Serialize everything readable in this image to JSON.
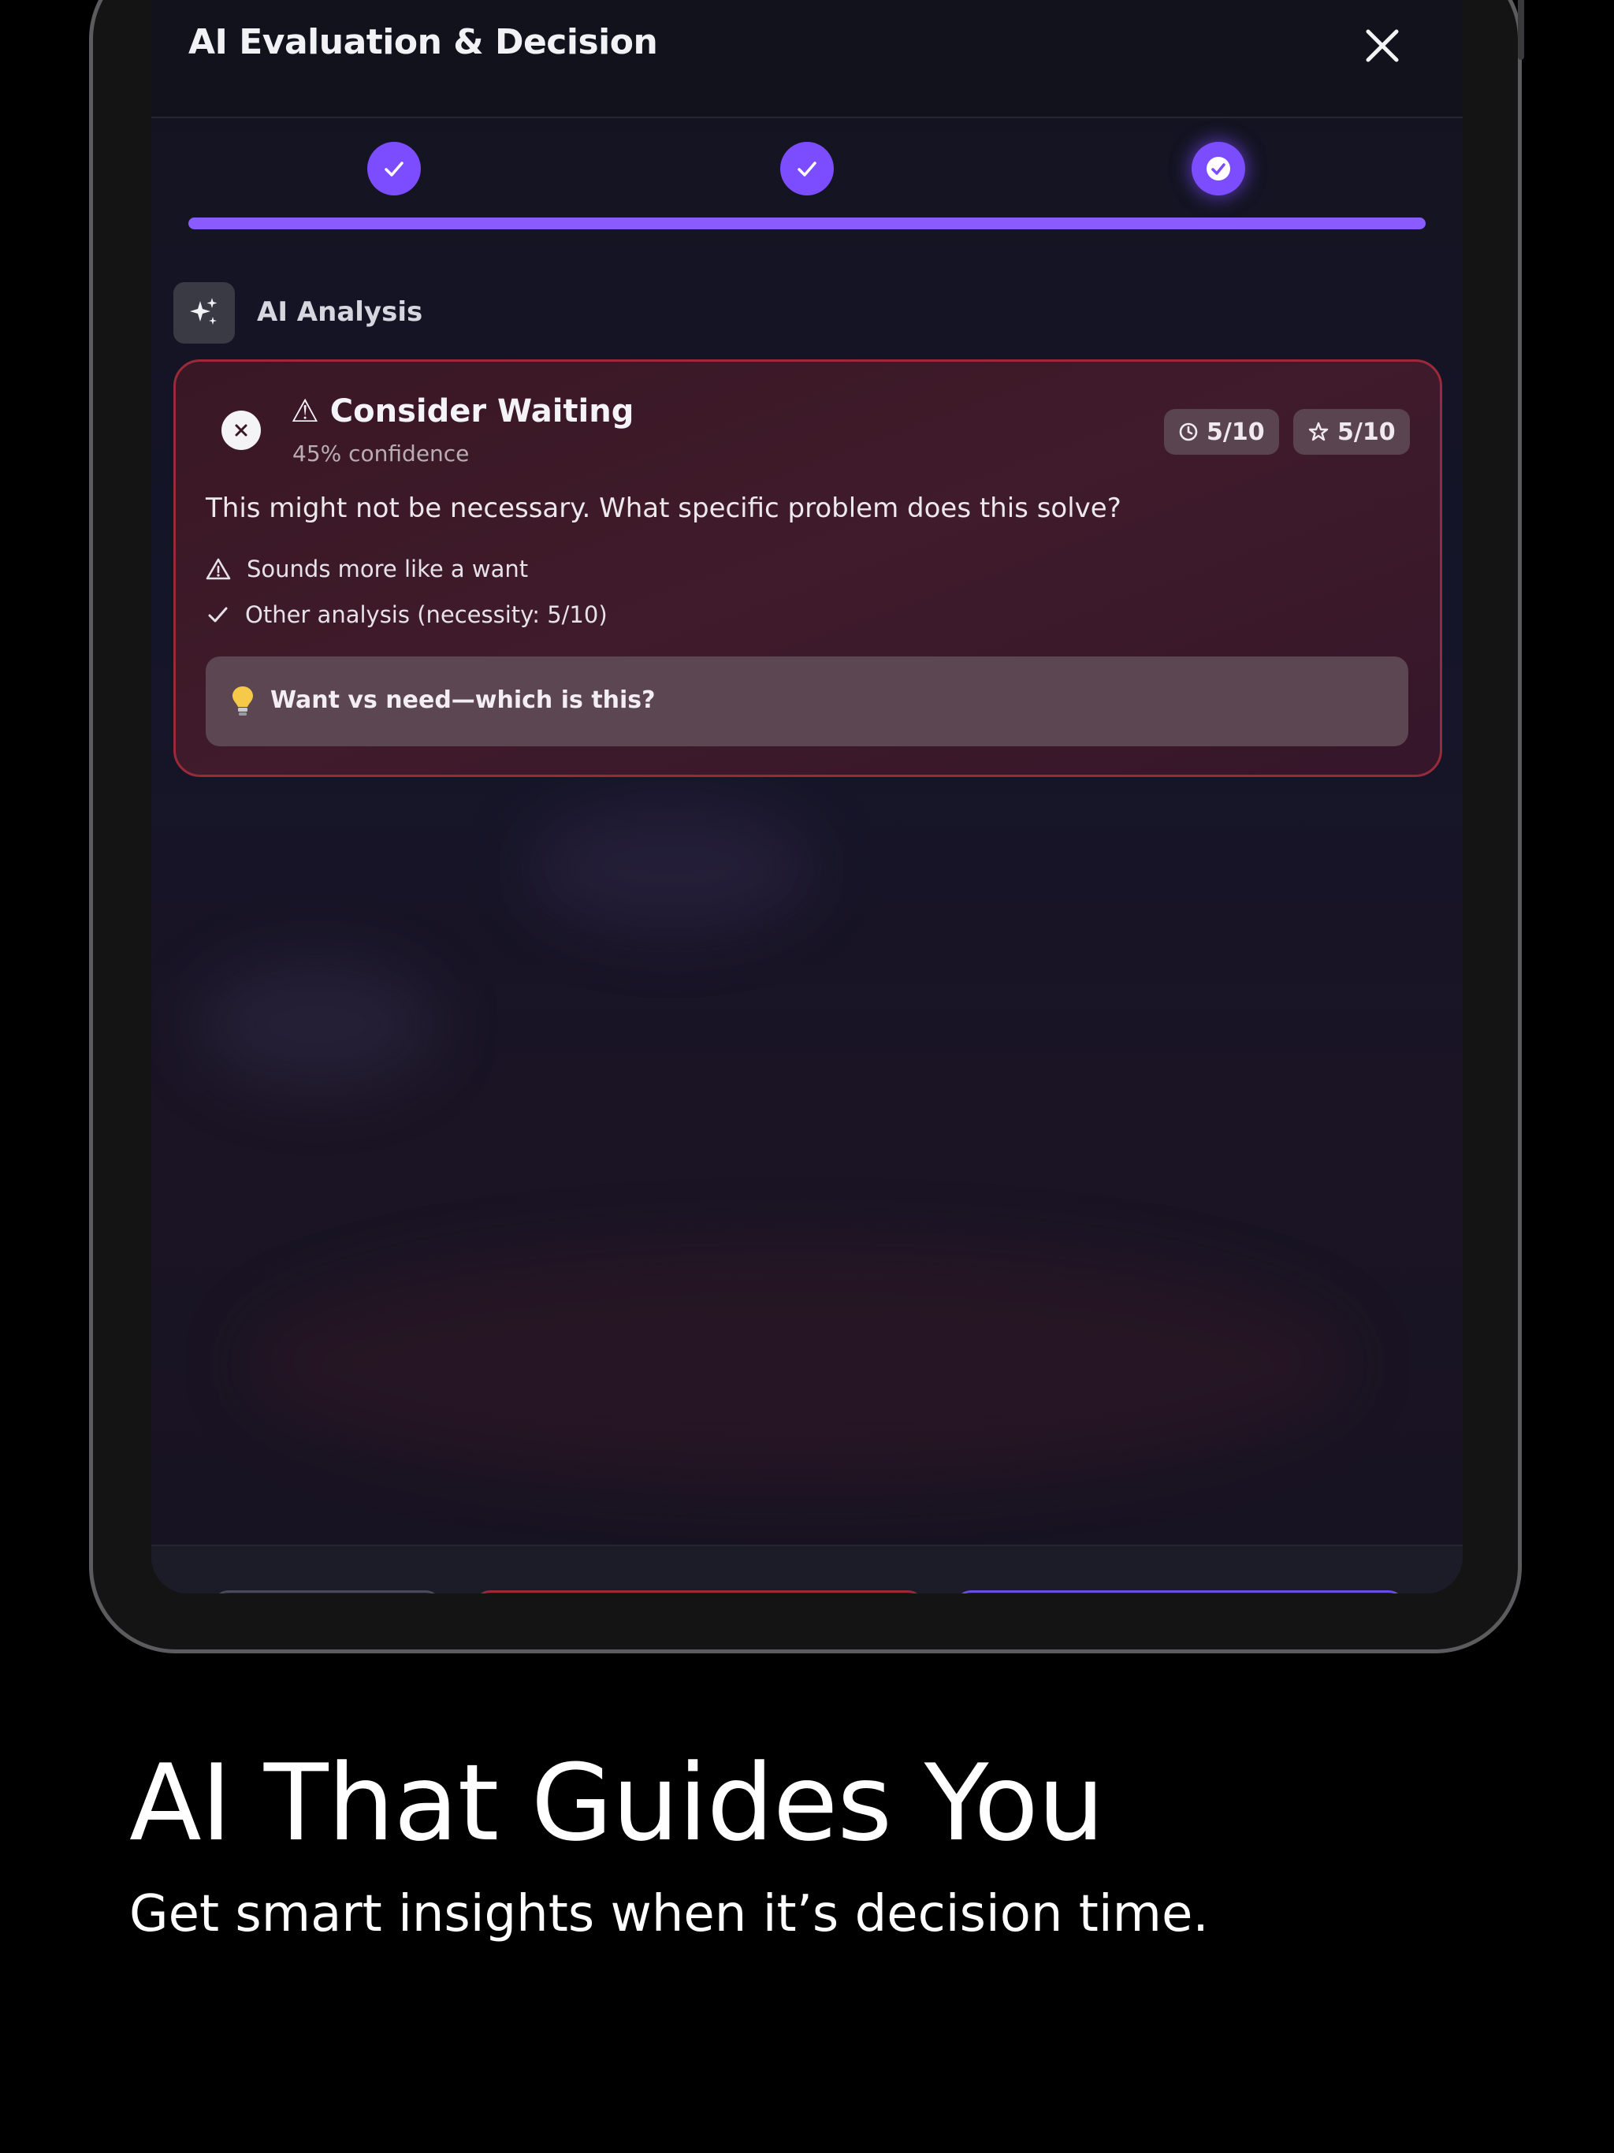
{
  "header": {
    "title": "AI Evaluation & Decision",
    "close_icon": "close-icon"
  },
  "steps": {
    "items": [
      {
        "state": "complete",
        "icon": "check-icon"
      },
      {
        "state": "complete",
        "icon": "check-icon"
      },
      {
        "state": "active",
        "icon": "check-circle-icon"
      }
    ],
    "progress": 1.0
  },
  "analysis": {
    "label": "AI Analysis",
    "icon": "sparkles-icon"
  },
  "verdict": {
    "icon": "dismiss-icon",
    "title": "⚠ Consider Waiting",
    "confidence": "45% confidence",
    "chips": [
      {
        "icon": "clock-icon",
        "label": "5/10"
      },
      {
        "icon": "star-icon",
        "label": "5/10"
      }
    ],
    "question": "This might not be necessary. What specific problem does this solve?",
    "points": [
      {
        "icon": "warning-icon",
        "text": "Sounds more like a want"
      },
      {
        "icon": "check-icon",
        "text": "Other analysis (necessity: 5/10)"
      }
    ],
    "tip": {
      "icon": "lightbulb-icon",
      "text": "Want vs need—which is this?"
    }
  },
  "marketing": {
    "headline": "AI That Guides You",
    "subline": "Get smart insights when it’s decision time."
  },
  "colors": {
    "accent": "#7c4dff",
    "card_border": "#9a2a3a",
    "background": "#000000"
  }
}
